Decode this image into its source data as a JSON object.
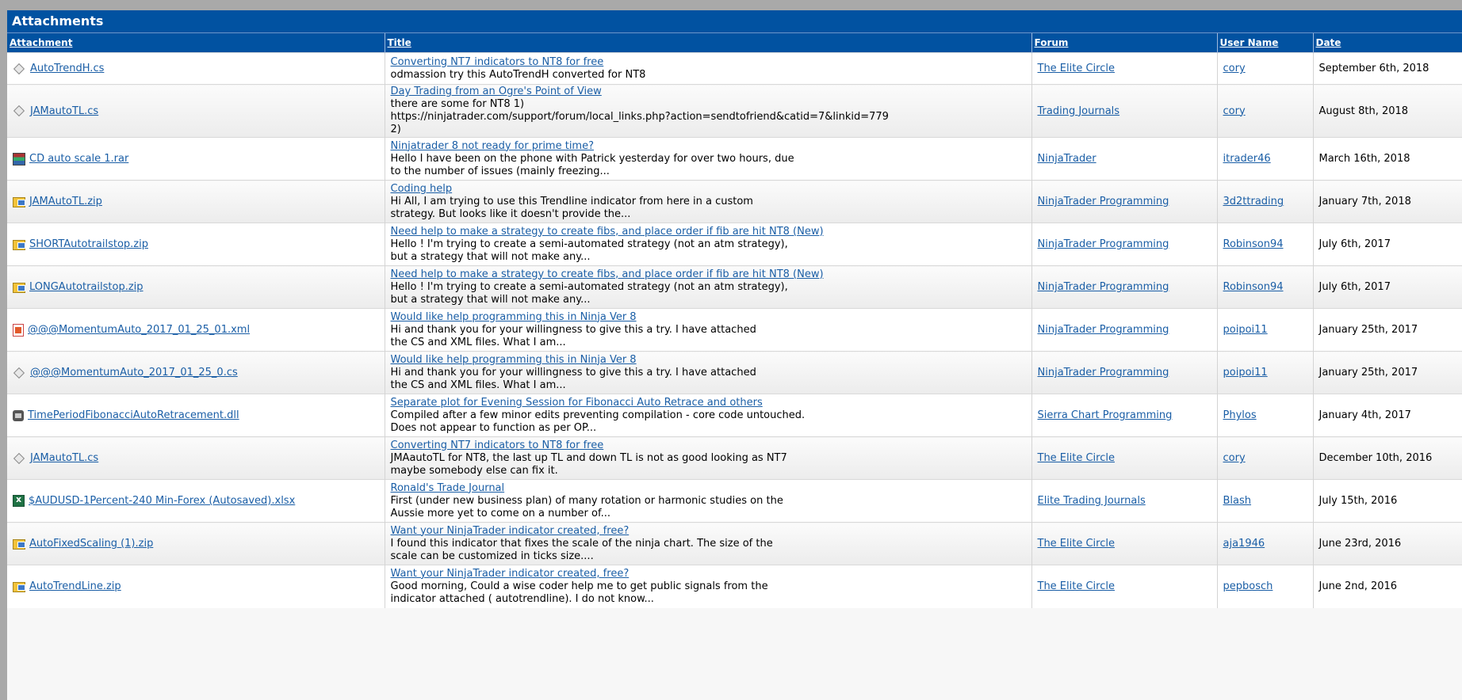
{
  "panel": {
    "title": "Attachments"
  },
  "columns": {
    "attachment": "Attachment",
    "title": "Title",
    "forum": "Forum",
    "user": "User Name",
    "date": "Date"
  },
  "rows": [
    {
      "icon": "cs-file-icon",
      "attachment": "AutoTrendH.cs",
      "title": "Converting NT7 indicators to NT8 for free",
      "snippet": "odmassion try this AutoTrendH converted for NT8",
      "forum": "The Elite Circle",
      "user": "cory",
      "date": "September 6th, 2018"
    },
    {
      "icon": "cs-file-icon",
      "attachment": "JAMautoTL.cs",
      "title": "Day Trading from an Ogre's Point of View",
      "snippet": "there are some for NT8 1)\nhttps://ninjatrader.com/support/forum/local_links.php?action=sendtofriend&catid=7&linkid=779\n2)",
      "forum": "Trading Journals",
      "user": "cory",
      "date": "August 8th, 2018"
    },
    {
      "icon": "rar-file-icon",
      "attachment": "CD auto scale 1.rar",
      "title": "Ninjatrader 8 not ready for prime time?",
      "snippet": "Hello I have been on the phone with Patrick yesterday for over two hours, due\nto the number of issues (mainly freezing...",
      "forum": "NinjaTrader",
      "user": "itrader46",
      "date": "March 16th, 2018"
    },
    {
      "icon": "zip-file-icon",
      "attachment": "JAMAutoTL.zip",
      "title": "Coding help",
      "snippet": "Hi All, I am trying to use this Trendline indicator from here in a custom\nstrategy. But looks like it doesn't provide the...",
      "forum": "NinjaTrader Programming",
      "user": "3d2ttrading",
      "date": "January 7th, 2018"
    },
    {
      "icon": "zip-file-icon",
      "attachment": "SHORTAutotrailstop.zip",
      "title": "Need help to make a strategy to create fibs, and place order if fib are hit NT8 (New)",
      "snippet": "Hello ! I'm trying to create a semi-automated strategy (not an atm strategy),\nbut a strategy that will not make any...",
      "forum": "NinjaTrader Programming",
      "user": "Robinson94",
      "date": "July 6th, 2017"
    },
    {
      "icon": "zip-file-icon",
      "attachment": "LONGAutotrailstop.zip",
      "title": "Need help to make a strategy to create fibs, and place order if fib are hit NT8 (New)",
      "snippet": "Hello ! I'm trying to create a semi-automated strategy (not an atm strategy),\nbut a strategy that will not make any...",
      "forum": "NinjaTrader Programming",
      "user": "Robinson94",
      "date": "July 6th, 2017"
    },
    {
      "icon": "xml-file-icon",
      "attachment": "@@@MomentumAuto_2017_01_25_01.xml",
      "title": "Would like help programming this in Ninja Ver 8",
      "snippet": "Hi and thank you for your willingness to give this a try. I have attached\nthe CS and XML files. What I am...",
      "forum": "NinjaTrader Programming",
      "user": "poipoi11",
      "date": "January 25th, 2017"
    },
    {
      "icon": "cs-file-icon",
      "attachment": "@@@MomentumAuto_2017_01_25_0.cs",
      "title": "Would like help programming this in Ninja Ver 8",
      "snippet": "Hi and thank you for your willingness to give this a try. I have attached\nthe CS and XML files. What I am...",
      "forum": "NinjaTrader Programming",
      "user": "poipoi11",
      "date": "January 25th, 2017"
    },
    {
      "icon": "dll-file-icon",
      "attachment": "TimePeriodFibonacciAutoRetracement.dll",
      "title": "Separate plot for Evening Session for Fibonacci Auto Retrace and others",
      "snippet": "Compiled after a few minor edits preventing compilation - core code untouched.\nDoes not appear to function as per OP...",
      "forum": "Sierra Chart Programming",
      "user": "Phylos",
      "date": "January 4th, 2017"
    },
    {
      "icon": "cs-file-icon",
      "attachment": "JAMautoTL.cs",
      "title": "Converting NT7 indicators to NT8 for free",
      "snippet": "JMAautoTL for NT8, the last up TL and down TL is not as good looking as NT7\nmaybe somebody else can fix it.",
      "forum": "The Elite Circle",
      "user": "cory",
      "date": "December 10th, 2016"
    },
    {
      "icon": "xlsx-file-icon",
      "attachment": "$AUDUSD-1Percent-240 Min-Forex (Autosaved).xlsx",
      "title": "Ronald's Trade Journal",
      "snippet": "First (under new business plan) of many rotation or harmonic studies on the\nAussie more yet to come on a number of...",
      "forum": "Elite Trading Journals",
      "user": "Blash",
      "date": "July 15th, 2016"
    },
    {
      "icon": "zip-file-icon",
      "attachment": "AutoFixedScaling (1).zip",
      "title": "Want your NinjaTrader indicator created, free?",
      "snippet": "I found this indicator that fixes the scale of the ninja chart. The size of the\nscale can be customized in ticks size....",
      "forum": "The Elite Circle",
      "user": "aja1946",
      "date": "June 23rd, 2016"
    },
    {
      "icon": "zip-file-icon",
      "attachment": "AutoTrendLine.zip",
      "title": "Want your NinjaTrader indicator created, free?",
      "snippet": "Good morning, Could a wise coder help me to get public signals from the\nindicator attached ( autotrendline). I do not know...",
      "forum": "The Elite Circle",
      "user": "pepbosch",
      "date": "June 2nd, 2016"
    }
  ]
}
